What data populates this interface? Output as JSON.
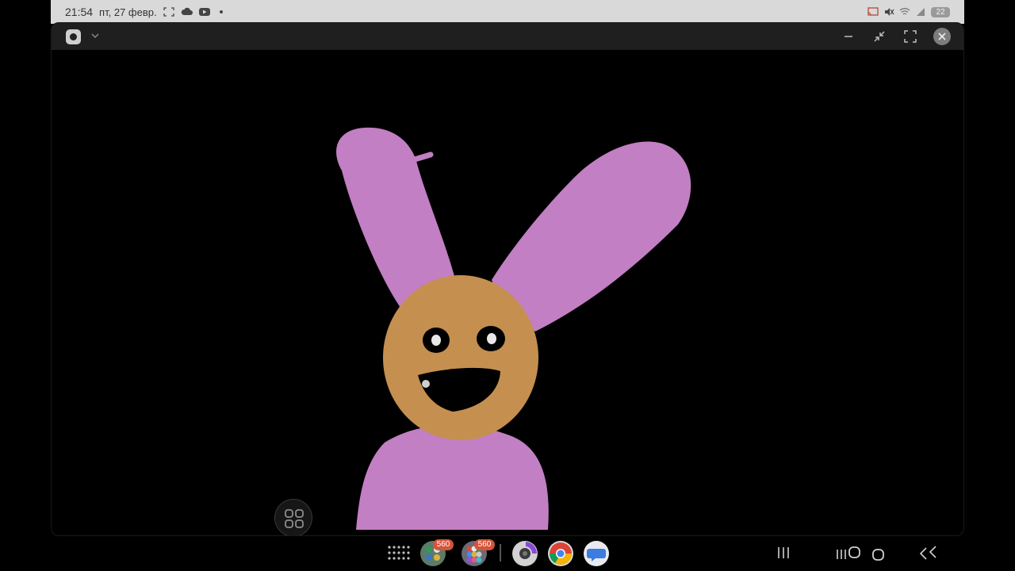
{
  "status_bar": {
    "time": "21:54",
    "date": "пт, 27 февр.",
    "left_icons": [
      "screenshot-icon",
      "cloud-icon",
      "youtube-icon",
      "dot-icon"
    ],
    "right_icons": [
      "cast-icon",
      "mute-icon",
      "wifi-icon",
      "signal-icon"
    ],
    "battery": "22"
  },
  "window": {
    "app_icon": "camera-app-icon",
    "controls": [
      "minimize-icon",
      "collapse-icon",
      "fullscreen-icon",
      "close-icon"
    ]
  },
  "drawing": {
    "description_colors": {
      "ears_body": "#c27fc3",
      "face": "#c58f4f",
      "features": "#000000"
    }
  },
  "taskbar": {
    "folder_1_badge": "560",
    "folder_2_badge": "560",
    "apps": [
      "apps-grid-icon",
      "folder-icon",
      "folder-icon",
      "camera-icon",
      "chrome-icon",
      "messages-icon"
    ],
    "nav": [
      "recents-icon",
      "recents-icon",
      "home-icon",
      "back-icon"
    ]
  },
  "colors": {
    "status_bar_bg": "#d9d9d9",
    "titlebar_bg": "#1f1f1f",
    "badge": "#d5543a"
  }
}
